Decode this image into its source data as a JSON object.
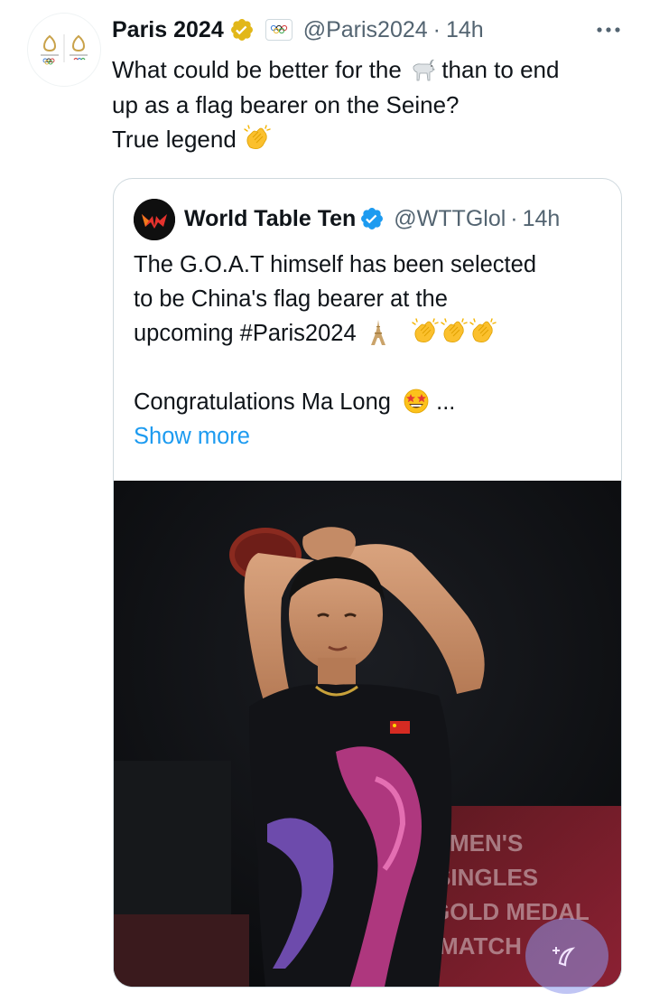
{
  "tweet": {
    "author": {
      "display_name": "Paris 2024",
      "handle": "@Paris2024",
      "verified_badge": "gold-check",
      "affiliate_badge": "olympic-rings-icon"
    },
    "time": "14h",
    "dot": "·",
    "text": {
      "line1_before": "What could be better for the",
      "line1_after": "than to end",
      "line2": "up as a flag bearer on the Seine?",
      "line3": "True legend"
    },
    "emojis": [
      "goat-emoji",
      "clapping-hands-emoji"
    ]
  },
  "quote": {
    "author": {
      "display_name": "World Table Ten",
      "handle": "@WTTGlol",
      "verified_badge": "blue-check"
    },
    "time": "14h",
    "dot": "·",
    "text": {
      "line1": "The G.O.A.T himself has been selected",
      "line2": "to be China's flag bearer at the",
      "line3": "upcoming #Paris2024",
      "line4": "Congratulations Ma Long",
      "ellipsis": "...",
      "show_more": "Show more"
    },
    "image": {
      "description_icon": "photo-table-tennis-player",
      "background_text": [
        "MEN'S",
        "SINGLES",
        "GOLD MEDAL",
        "MATCH"
      ]
    }
  },
  "colors": {
    "link_blue": "#1d9bf0",
    "secondary_text": "#536471",
    "border": "#cfd9de",
    "gold_badge": "#e2b719"
  }
}
